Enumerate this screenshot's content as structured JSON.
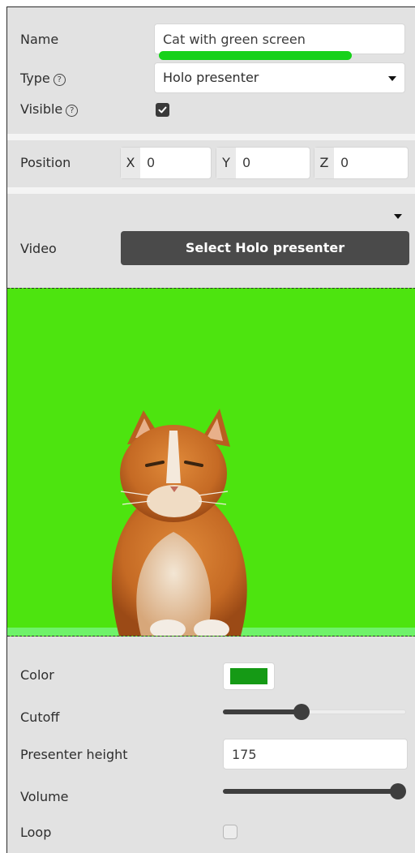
{
  "object": {
    "name_label": "Name",
    "name_value": "Cat with green screen",
    "type_label": "Type",
    "type_value": "Holo presenter",
    "visible_label": "Visible",
    "visible_checked": true,
    "help_glyph": "?"
  },
  "position": {
    "label": "Position",
    "x_axis": "X",
    "x_value": "0",
    "y_axis": "Y",
    "y_value": "0",
    "z_axis": "Z",
    "z_value": "0"
  },
  "video": {
    "label": "Video",
    "select_button": "Select Holo presenter"
  },
  "settings": {
    "color_label": "Color",
    "color_value": "#159a15",
    "cutoff_label": "Cutoff",
    "cutoff_fraction": 0.42,
    "height_label": "Presenter height",
    "height_value": "175",
    "volume_label": "Volume",
    "volume_fraction": 1.0,
    "loop_label": "Loop",
    "loop_checked": false
  },
  "colors": {
    "green_screen": "#4de40f",
    "accent_green": "#16d11a",
    "button_dark": "#4a4a4a"
  }
}
